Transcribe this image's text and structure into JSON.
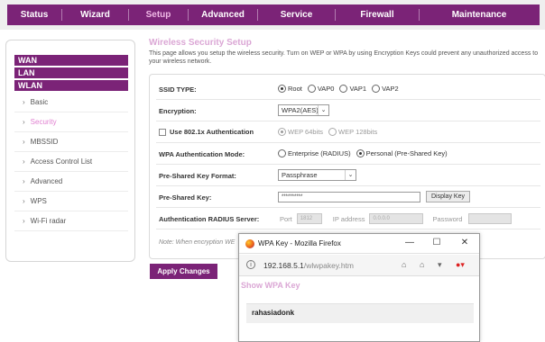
{
  "nav": {
    "items": [
      "Status",
      "Wizard",
      "Setup",
      "Advanced",
      "Service",
      "Firewall",
      "Maintenance"
    ],
    "active": "Setup"
  },
  "sidebar": {
    "groups": [
      "WAN",
      "LAN",
      "WLAN"
    ],
    "items": [
      "Basic",
      "Security",
      "MBSSID",
      "Access Control List",
      "Advanced",
      "WPS",
      "Wi-Fi radar"
    ],
    "active_item": "Security"
  },
  "page": {
    "title": "Wireless Security Setup",
    "description": "This page allows you setup the wireless security. Turn on WEP or WPA by using Encryption Keys could prevent any unauthorized access to your wireless network."
  },
  "form": {
    "ssid_type": {
      "label": "SSID TYPE:",
      "options": [
        "Root",
        "VAP0",
        "VAP1",
        "VAP2"
      ],
      "selected": "Root"
    },
    "encryption": {
      "label": "Encryption:",
      "value": "WPA2(AES)"
    },
    "auth8021x": {
      "label": "Use 802.1x Authentication",
      "checked": false,
      "options": [
        "WEP 64bits",
        "WEP 128bits"
      ],
      "selected": "WEP 64bits"
    },
    "wpa_auth_mode": {
      "label": "WPA Authentication Mode:",
      "options": [
        "Enterprise (RADIUS)",
        "Personal (Pre-Shared Key)"
      ],
      "selected": "Personal (Pre-Shared Key)"
    },
    "psk_format": {
      "label": "Pre-Shared Key Format:",
      "value": "Passphrase"
    },
    "psk": {
      "label": "Pre-Shared Key:",
      "masked_value": "**********",
      "display_button": "Display Key"
    },
    "radius": {
      "label": "Authentication RADIUS Server:",
      "port_label": "Port",
      "port_value": "1812",
      "ip_label": "IP address",
      "ip_value": "0.0.0.0",
      "password_label": "Password",
      "password_value": ""
    },
    "note": "Note: When encryption WE"
  },
  "apply_button": "Apply Changes",
  "popup": {
    "window_title": "WPA Key - Mozilla Firefox",
    "url_host": "192.168.5.1",
    "url_path": "/wlwpakey.htm",
    "heading": "Show WPA Key",
    "key_value": "rahasiadonk",
    "buttons": {
      "minimize": "—",
      "maximize": "☐",
      "close": "✕"
    }
  },
  "colors": {
    "brand": "#7b2377",
    "accent_text": "#dba7d5",
    "active_link": "#e07fd0"
  }
}
